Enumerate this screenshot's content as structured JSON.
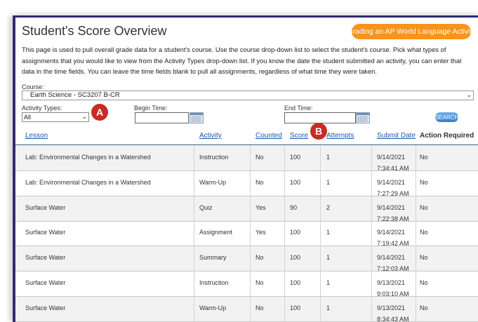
{
  "page": {
    "title": "Student's Score Overview",
    "help_button": "Grading an AP World Language Activity",
    "description": "This page is used to pull overall grade data for a student's course. Use the course drop-down list to select the student's course. Pick what types of assignments that you would like to view from the Activity Types drop-down list. If you know the date the student submitted an activity, you can enter that data in the time fields. You can leave the time fields blank to pull all assignments, regardless of what time they were taken."
  },
  "filters": {
    "course_label": "Course:",
    "course_value": "Earth Science - SC3207 B-CR",
    "activity_types_label": "Activity Types:",
    "activity_types_value": "All",
    "begin_time_label": "Begin Time:",
    "end_time_label": "End Time:",
    "search_label": "SEARCH"
  },
  "markers": {
    "a": "A",
    "b": "B"
  },
  "table": {
    "columns": [
      "Lesson",
      "Activity",
      "Counted",
      "Score",
      "Attempts",
      "Submit Date",
      "Action Required"
    ],
    "rows": [
      {
        "lesson": "Lab: Environmental Changes in a Watershed",
        "activity": "Instruction",
        "counted": "No",
        "score": "100",
        "attempts": "1",
        "date": "9/14/2021",
        "time": "7:34:41 AM",
        "action": "No"
      },
      {
        "lesson": "Lab: Environmental Changes in a Watershed",
        "activity": "Warm-Up",
        "counted": "No",
        "score": "100",
        "attempts": "1",
        "date": "9/14/2021",
        "time": "7:27:29 AM",
        "action": "No"
      },
      {
        "lesson": "Surface Water",
        "activity": "Quiz",
        "counted": "Yes",
        "score": "90",
        "attempts": "2",
        "date": "9/14/2021",
        "time": "7:22:38 AM",
        "action": "No"
      },
      {
        "lesson": "Surface Water",
        "activity": "Assignment",
        "counted": "Yes",
        "score": "100",
        "attempts": "1",
        "date": "9/14/2021",
        "time": "7:19:42 AM",
        "action": "No"
      },
      {
        "lesson": "Surface Water",
        "activity": "Summary",
        "counted": "No",
        "score": "100",
        "attempts": "1",
        "date": "9/14/2021",
        "time": "7:12:03 AM",
        "action": "No"
      },
      {
        "lesson": "Surface Water",
        "activity": "Instruction",
        "counted": "No",
        "score": "100",
        "attempts": "1",
        "date": "9/13/2021",
        "time": "9:03:10 AM",
        "action": "No"
      },
      {
        "lesson": "Surface Water",
        "activity": "Warm-Up",
        "counted": "No",
        "score": "100",
        "attempts": "1",
        "date": "9/13/2021",
        "time": "8:34:43 AM",
        "action": "No"
      }
    ]
  },
  "colors": {
    "accent": "#f7941d",
    "link": "#1a57b6",
    "marker": "#c62d23",
    "frame": "#2f2d6e"
  }
}
